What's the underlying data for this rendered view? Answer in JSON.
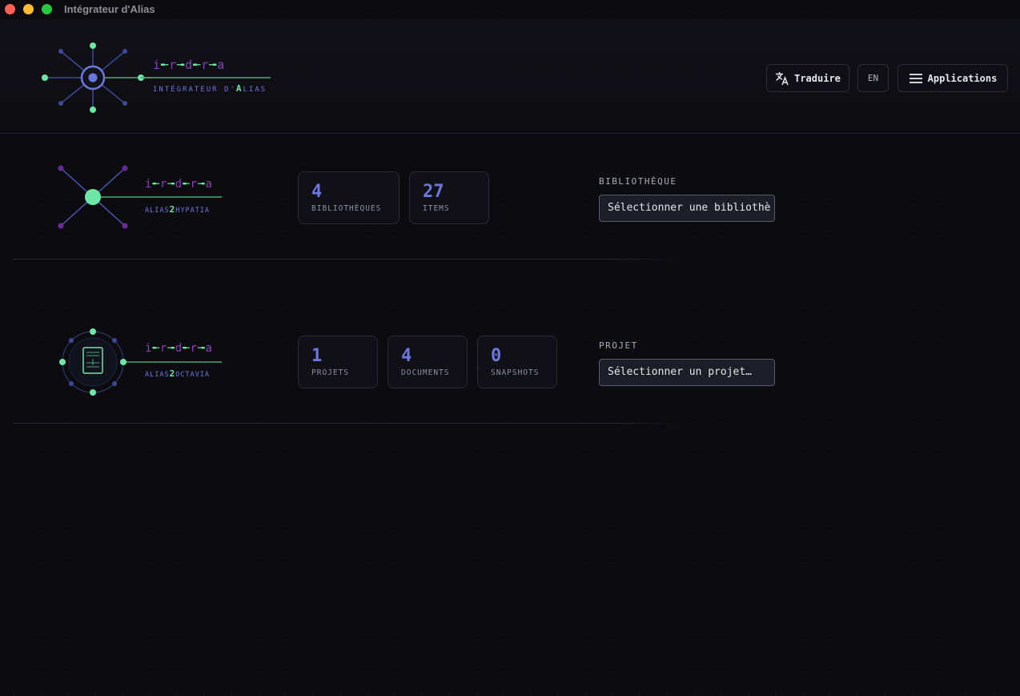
{
  "window": {
    "title": "Intégrateur d'Alias"
  },
  "brand": {
    "irda": [
      "i",
      "r",
      "d",
      "r",
      "a"
    ],
    "subtitle_pre": "INTÉGRATEUR D'",
    "subtitle_a": "A",
    "subtitle_post": "LIAS"
  },
  "header": {
    "translate_label": "Traduire",
    "translate_icon": "translate-icon",
    "lang_label": "EN",
    "apps_label": "Applications",
    "apps_icon": "hamburger-menu-icon"
  },
  "hypatia": {
    "sub_pre": "ALIAS",
    "sub_two": "2",
    "sub_post": "HYPATIA",
    "stats": [
      {
        "value": "4",
        "label": "BIBLIOTHÈQUES"
      },
      {
        "value": "27",
        "label": "ITEMS"
      }
    ],
    "field_label": "BIBLIOTHÈQUE",
    "select_value": "Sélectionner une bibliothè"
  },
  "octavia": {
    "sub_pre": "ALIAS",
    "sub_two": "2",
    "sub_post": "OCTAVIA",
    "stats": [
      {
        "value": "1",
        "label": "PROJETS"
      },
      {
        "value": "4",
        "label": "DOCUMENTS"
      },
      {
        "value": "0",
        "label": "SNAPSHOTS"
      }
    ],
    "field_label": "PROJET",
    "select_value": "Sélectionner un projet…"
  },
  "colors": {
    "accent_blue": "#6b78e0",
    "accent_green": "#6ee7a4",
    "accent_purple": "#8a3fbf",
    "background": "#0c0c10"
  }
}
